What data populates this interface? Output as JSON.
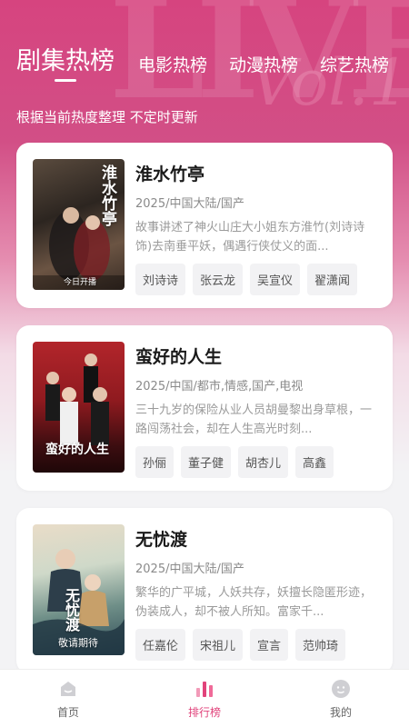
{
  "tabs": [
    {
      "label": "剧集热榜",
      "active": true
    },
    {
      "label": "电影热榜",
      "active": false
    },
    {
      "label": "动漫热榜",
      "active": false
    },
    {
      "label": "综艺热榜",
      "active": false
    }
  ],
  "hero_deco": {
    "big": "LIVE",
    "small": "Vol.1"
  },
  "subtitle": "根据当前热度整理 不定时更新",
  "items": [
    {
      "title": "淮水竹亭",
      "meta": "2025/中国大陆/国产",
      "desc": "故事讲述了神火山庄大小姐东方淮竹(刘诗诗 饰)去南垂平妖，偶遇行侠仗义的面...",
      "actors": [
        "刘诗诗",
        "张云龙",
        "吴宣仪",
        "翟潇闻"
      ],
      "poster_title": "淮水竹亭",
      "poster_caption": "今日开播"
    },
    {
      "title": "蛮好的人生",
      "meta": "2025/中国/都市,情感,国产,电视",
      "desc": "三十九岁的保险从业人员胡曼黎出身草根，一路闯荡社会，却在人生高光时刻...",
      "actors": [
        "孙俪",
        "董子健",
        "胡杏儿",
        "高鑫"
      ],
      "poster_title": "蛮好的人生",
      "poster_caption": ""
    },
    {
      "title": "无忧渡",
      "meta": "2025/中国大陆/国产",
      "desc": "繁华的广平城，人妖共存，妖擅长隐匿形迹，伪装成人，却不被人所知。富家千...",
      "actors": [
        "任嘉伦",
        "宋祖儿",
        "宣言",
        "范帅琦"
      ],
      "poster_title": "无忧渡",
      "poster_caption": "敬请期待"
    }
  ],
  "nav": [
    {
      "label": "首页",
      "icon": "home-icon",
      "active": false
    },
    {
      "label": "排行榜",
      "icon": "ranking-icon",
      "active": true
    },
    {
      "label": "我的",
      "icon": "profile-icon",
      "active": false
    }
  ],
  "colors": {
    "accent": "#e1437b",
    "hero": "#d6447f"
  }
}
